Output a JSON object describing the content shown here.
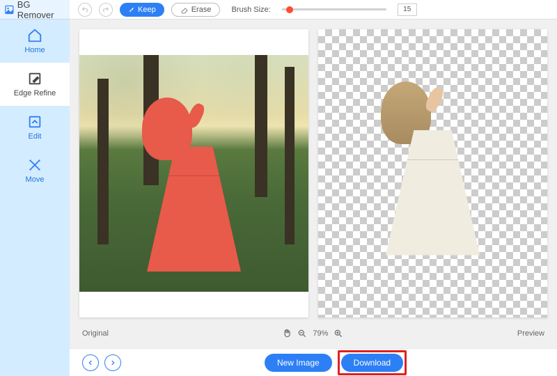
{
  "brand": {
    "name": "BG Remover"
  },
  "sidebar": {
    "items": [
      {
        "label": "Home",
        "name": "home"
      },
      {
        "label": "Edge Refine",
        "name": "edge-refine"
      },
      {
        "label": "Edit",
        "name": "edit"
      },
      {
        "label": "Move",
        "name": "move"
      }
    ],
    "active_index": 1
  },
  "toolbar": {
    "keep_label": "Keep",
    "erase_label": "Erase",
    "brush_label": "Brush Size:",
    "brush_value": "15"
  },
  "panels": {
    "left_caption": "Original",
    "right_caption": "Preview"
  },
  "status": {
    "zoom": "79%"
  },
  "bottom": {
    "new_image_label": "New Image",
    "download_label": "Download"
  },
  "icons": {
    "home": "home-icon",
    "edge_refine": "edge-refine-icon",
    "edit": "edit-icon",
    "move": "move-icon"
  }
}
